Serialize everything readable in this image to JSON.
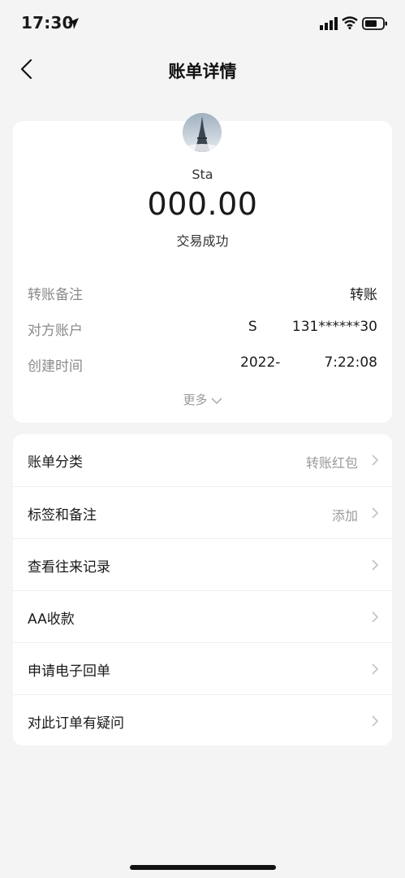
{
  "status_bar": {
    "time": "17:30"
  },
  "header": {
    "title": "账单详情"
  },
  "summary": {
    "payee": "Sta",
    "amount": "000.00",
    "status": "交易成功",
    "rows": [
      {
        "label": "转账备注",
        "value": "转账"
      },
      {
        "label": "对方账户",
        "value": "S        131******30"
      },
      {
        "label": "创建时间",
        "value": "2022-          7:22:08"
      }
    ],
    "more_label": "更多"
  },
  "menu": [
    {
      "label": "账单分类",
      "value": "转账红包"
    },
    {
      "label": "标签和备注",
      "value": "添加"
    },
    {
      "label": "查看往来记录",
      "value": ""
    },
    {
      "label": "AA收款",
      "value": ""
    },
    {
      "label": "申请电子回单",
      "value": ""
    },
    {
      "label": "对此订单有疑问",
      "value": ""
    }
  ]
}
